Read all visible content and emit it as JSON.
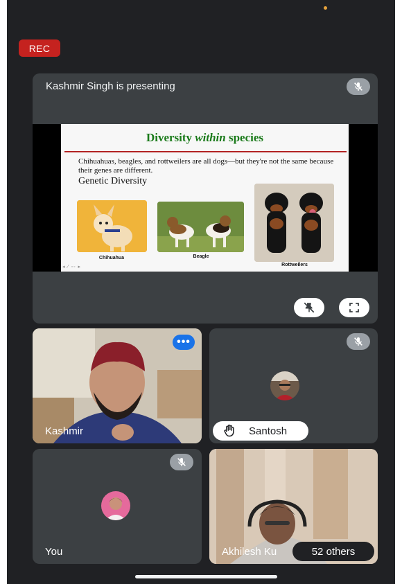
{
  "recording": {
    "label": "REC"
  },
  "presentation": {
    "title": "Kashmir Singh is presenting",
    "slide": {
      "heading_pre": "Diversity ",
      "heading_em": "within",
      "heading_post": " species",
      "body": "Chihuahuas, beagles, and rottweilers are all dogs—but they're not the same because their genes are different.",
      "subheading": "Genetic Diversity",
      "captions": [
        "Chihuahua",
        "Beagle",
        "Rottweilers"
      ]
    }
  },
  "participants": {
    "kashmir": {
      "name": "Kashmir"
    },
    "santosh": {
      "name": "Santosh"
    },
    "you": {
      "name": "You"
    },
    "akhilesh": {
      "name": "Akhilesh Ku"
    }
  },
  "others": {
    "label": "52 others"
  },
  "colors": {
    "rec": "#c5221f",
    "tile": "#3c4043",
    "background": "#202124",
    "accent": "#1a73e8"
  }
}
